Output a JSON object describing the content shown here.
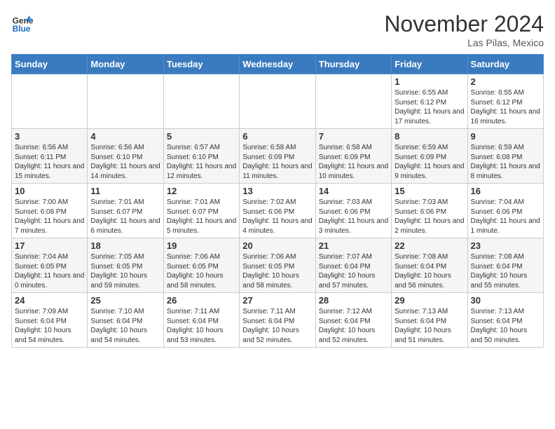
{
  "header": {
    "logo_general": "General",
    "logo_blue": "Blue",
    "month": "November 2024",
    "location": "Las Pilas, Mexico"
  },
  "days_of_week": [
    "Sunday",
    "Monday",
    "Tuesday",
    "Wednesday",
    "Thursday",
    "Friday",
    "Saturday"
  ],
  "weeks": [
    [
      {
        "day": "",
        "info": ""
      },
      {
        "day": "",
        "info": ""
      },
      {
        "day": "",
        "info": ""
      },
      {
        "day": "",
        "info": ""
      },
      {
        "day": "",
        "info": ""
      },
      {
        "day": "1",
        "info": "Sunrise: 6:55 AM\nSunset: 6:12 PM\nDaylight: 11 hours and 17 minutes."
      },
      {
        "day": "2",
        "info": "Sunrise: 6:55 AM\nSunset: 6:12 PM\nDaylight: 11 hours and 16 minutes."
      }
    ],
    [
      {
        "day": "3",
        "info": "Sunrise: 6:56 AM\nSunset: 6:11 PM\nDaylight: 11 hours and 15 minutes."
      },
      {
        "day": "4",
        "info": "Sunrise: 6:56 AM\nSunset: 6:10 PM\nDaylight: 11 hours and 14 minutes."
      },
      {
        "day": "5",
        "info": "Sunrise: 6:57 AM\nSunset: 6:10 PM\nDaylight: 11 hours and 12 minutes."
      },
      {
        "day": "6",
        "info": "Sunrise: 6:58 AM\nSunset: 6:09 PM\nDaylight: 11 hours and 11 minutes."
      },
      {
        "day": "7",
        "info": "Sunrise: 6:58 AM\nSunset: 6:09 PM\nDaylight: 11 hours and 10 minutes."
      },
      {
        "day": "8",
        "info": "Sunrise: 6:59 AM\nSunset: 6:09 PM\nDaylight: 11 hours and 9 minutes."
      },
      {
        "day": "9",
        "info": "Sunrise: 6:59 AM\nSunset: 6:08 PM\nDaylight: 11 hours and 8 minutes."
      }
    ],
    [
      {
        "day": "10",
        "info": "Sunrise: 7:00 AM\nSunset: 6:08 PM\nDaylight: 11 hours and 7 minutes."
      },
      {
        "day": "11",
        "info": "Sunrise: 7:01 AM\nSunset: 6:07 PM\nDaylight: 11 hours and 6 minutes."
      },
      {
        "day": "12",
        "info": "Sunrise: 7:01 AM\nSunset: 6:07 PM\nDaylight: 11 hours and 5 minutes."
      },
      {
        "day": "13",
        "info": "Sunrise: 7:02 AM\nSunset: 6:06 PM\nDaylight: 11 hours and 4 minutes."
      },
      {
        "day": "14",
        "info": "Sunrise: 7:03 AM\nSunset: 6:06 PM\nDaylight: 11 hours and 3 minutes."
      },
      {
        "day": "15",
        "info": "Sunrise: 7:03 AM\nSunset: 6:06 PM\nDaylight: 11 hours and 2 minutes."
      },
      {
        "day": "16",
        "info": "Sunrise: 7:04 AM\nSunset: 6:06 PM\nDaylight: 11 hours and 1 minute."
      }
    ],
    [
      {
        "day": "17",
        "info": "Sunrise: 7:04 AM\nSunset: 6:05 PM\nDaylight: 11 hours and 0 minutes."
      },
      {
        "day": "18",
        "info": "Sunrise: 7:05 AM\nSunset: 6:05 PM\nDaylight: 10 hours and 59 minutes."
      },
      {
        "day": "19",
        "info": "Sunrise: 7:06 AM\nSunset: 6:05 PM\nDaylight: 10 hours and 58 minutes."
      },
      {
        "day": "20",
        "info": "Sunrise: 7:06 AM\nSunset: 6:05 PM\nDaylight: 10 hours and 58 minutes."
      },
      {
        "day": "21",
        "info": "Sunrise: 7:07 AM\nSunset: 6:04 PM\nDaylight: 10 hours and 57 minutes."
      },
      {
        "day": "22",
        "info": "Sunrise: 7:08 AM\nSunset: 6:04 PM\nDaylight: 10 hours and 56 minutes."
      },
      {
        "day": "23",
        "info": "Sunrise: 7:08 AM\nSunset: 6:04 PM\nDaylight: 10 hours and 55 minutes."
      }
    ],
    [
      {
        "day": "24",
        "info": "Sunrise: 7:09 AM\nSunset: 6:04 PM\nDaylight: 10 hours and 54 minutes."
      },
      {
        "day": "25",
        "info": "Sunrise: 7:10 AM\nSunset: 6:04 PM\nDaylight: 10 hours and 54 minutes."
      },
      {
        "day": "26",
        "info": "Sunrise: 7:11 AM\nSunset: 6:04 PM\nDaylight: 10 hours and 53 minutes."
      },
      {
        "day": "27",
        "info": "Sunrise: 7:11 AM\nSunset: 6:04 PM\nDaylight: 10 hours and 52 minutes."
      },
      {
        "day": "28",
        "info": "Sunrise: 7:12 AM\nSunset: 6:04 PM\nDaylight: 10 hours and 52 minutes."
      },
      {
        "day": "29",
        "info": "Sunrise: 7:13 AM\nSunset: 6:04 PM\nDaylight: 10 hours and 51 minutes."
      },
      {
        "day": "30",
        "info": "Sunrise: 7:13 AM\nSunset: 6:04 PM\nDaylight: 10 hours and 50 minutes."
      }
    ]
  ]
}
